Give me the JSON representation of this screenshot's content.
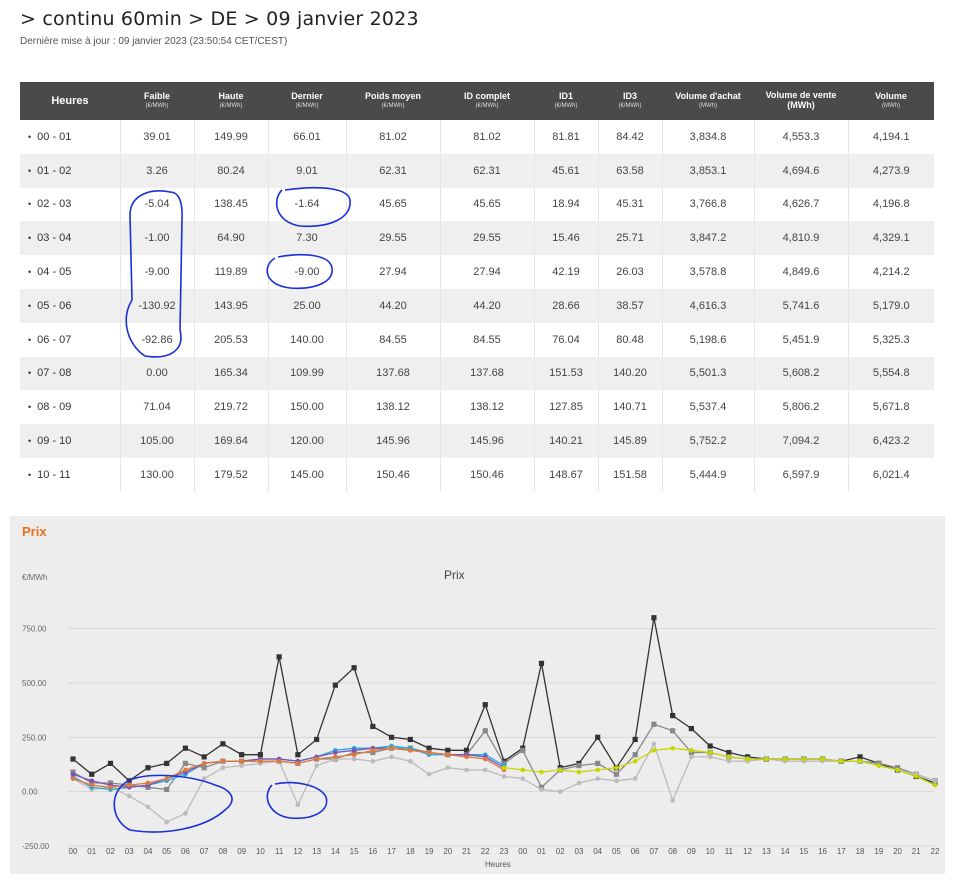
{
  "page": {
    "title": "> continu 60min > DE > 09 janvier 2023",
    "subtitle": "Dernière mise à jour : 09 janvier 2023 (23:50:54 CET/CEST)"
  },
  "table": {
    "headers": [
      {
        "label": "Heures",
        "unit": ""
      },
      {
        "label": "Faible",
        "unit": "(€/MWh)"
      },
      {
        "label": "Haute",
        "unit": "(€/MWh)"
      },
      {
        "label": "Dernier",
        "unit": "(€/MWh)"
      },
      {
        "label": "Poids moyen",
        "unit": "(€/MWh)"
      },
      {
        "label": "ID complet",
        "unit": "(€/MWh)"
      },
      {
        "label": "ID1",
        "unit": "(€/MWh)"
      },
      {
        "label": "ID3",
        "unit": "(€/MWh)"
      },
      {
        "label": "Volume d'achat",
        "unit": "(MWh)"
      },
      {
        "label": "Volume de vente (MWh)",
        "unit": ""
      },
      {
        "label": "Volume",
        "unit": "(MWh)"
      }
    ],
    "rows": [
      [
        "00 - 01",
        "39.01",
        "149.99",
        "66.01",
        "81.02",
        "81.02",
        "81.81",
        "84.42",
        "3,834.8",
        "4,553.3",
        "4,194.1"
      ],
      [
        "01 - 02",
        "3.26",
        "80.24",
        "9.01",
        "62.31",
        "62.31",
        "45.61",
        "63.58",
        "3,853.1",
        "4,694.6",
        "4,273.9"
      ],
      [
        "02 - 03",
        "-5.04",
        "138.45",
        "-1.64",
        "45.65",
        "45.65",
        "18.94",
        "45.31",
        "3,766.8",
        "4,626.7",
        "4,196.8"
      ],
      [
        "03 - 04",
        "-1.00",
        "64.90",
        "7.30",
        "29.55",
        "29.55",
        "15.46",
        "25.71",
        "3,847.2",
        "4,810.9",
        "4,329.1"
      ],
      [
        "04 - 05",
        "-9.00",
        "119.89",
        "-9.00",
        "27.94",
        "27.94",
        "42.19",
        "26.03",
        "3,578.8",
        "4,849.6",
        "4,214.2"
      ],
      [
        "05 - 06",
        "-130.92",
        "143.95",
        "25.00",
        "44.20",
        "44.20",
        "28.66",
        "38.57",
        "4,616.3",
        "5,741.6",
        "5,179.0"
      ],
      [
        "06 - 07",
        "-92.86",
        "205.53",
        "140.00",
        "84.55",
        "84.55",
        "76.04",
        "80.48",
        "5,198.6",
        "5,451.9",
        "5,325.3"
      ],
      [
        "07 - 08",
        "0.00",
        "165.34",
        "109.99",
        "137.68",
        "137.68",
        "151.53",
        "140.20",
        "5,501.3",
        "5,608.2",
        "5,554.8"
      ],
      [
        "08 - 09",
        "71.04",
        "219.72",
        "150.00",
        "138.12",
        "138.12",
        "127.85",
        "140.71",
        "5,537.4",
        "5,806.2",
        "5,671.8"
      ],
      [
        "09 - 10",
        "105.00",
        "169.64",
        "120.00",
        "145.96",
        "145.96",
        "140.21",
        "145.89",
        "5,752.2",
        "7,094.2",
        "6,423.2"
      ],
      [
        "10 - 11",
        "130.00",
        "179.52",
        "145.00",
        "150.46",
        "150.46",
        "148.67",
        "151.58",
        "5,444.9",
        "6,597.9",
        "6,021.4"
      ]
    ]
  },
  "chart_panel": {
    "tab_title": "Prix",
    "title": "Prix",
    "unit_label": "€/MWh",
    "xlabel": "Heures"
  },
  "chart_data": {
    "type": "line",
    "title": "Prix",
    "ylabel": "€/MWh",
    "xlabel": "Heures",
    "ylim": [
      -250,
      900
    ],
    "yticks": [
      "750.00",
      "500.00",
      "250.00",
      "0.00",
      "-250.00"
    ],
    "ytick_values": [
      750,
      500,
      250,
      0,
      -250
    ],
    "x": [
      "00",
      "01",
      "02",
      "03",
      "04",
      "05",
      "06",
      "07",
      "08",
      "09",
      "10",
      "11",
      "12",
      "13",
      "14",
      "15",
      "16",
      "17",
      "18",
      "19",
      "20",
      "21",
      "22",
      "23",
      "00",
      "01",
      "02",
      "03",
      "04",
      "05",
      "06",
      "07",
      "08",
      "09",
      "10",
      "11",
      "12",
      "13",
      "14",
      "15",
      "16",
      "17",
      "18",
      "19",
      "20",
      "21",
      "22"
    ],
    "grid": true,
    "series": [
      {
        "color": "#333333",
        "marker": "square",
        "values": [
          150,
          80,
          130,
          50,
          110,
          130,
          200,
          160,
          220,
          170,
          170,
          620,
          170,
          240,
          490,
          570,
          300,
          250,
          240,
          200,
          190,
          190,
          400,
          140,
          200,
          590,
          110,
          130,
          250,
          110,
          240,
          800,
          350,
          290,
          210,
          180,
          160,
          150,
          150,
          150,
          150,
          140,
          160,
          130,
          100,
          70,
          40
        ]
      },
      {
        "color": "#888888",
        "marker": "square",
        "values": [
          90,
          40,
          40,
          30,
          20,
          10,
          130,
          110,
          140,
          140,
          140,
          140,
          130,
          150,
          150,
          180,
          180,
          200,
          200,
          180,
          170,
          170,
          280,
          130,
          190,
          20,
          100,
          120,
          130,
          80,
          170,
          310,
          280,
          180,
          180,
          160,
          150,
          150,
          150,
          150,
          150,
          140,
          140,
          130,
          110,
          80,
          50
        ]
      },
      {
        "color": "#bbbbbb",
        "marker": "circle",
        "values": [
          60,
          10,
          20,
          -20,
          -70,
          -140,
          -100,
          60,
          110,
          120,
          130,
          140,
          -60,
          120,
          150,
          150,
          140,
          160,
          140,
          80,
          110,
          100,
          100,
          70,
          60,
          10,
          0,
          40,
          60,
          50,
          60,
          220,
          -40,
          160,
          160,
          140,
          140,
          150,
          140,
          140,
          140,
          140,
          140,
          120,
          100,
          80,
          50
        ]
      },
      {
        "color": "#2aa8e0",
        "marker": "circle",
        "values": [
          70,
          20,
          10,
          20,
          30,
          50,
          80,
          130,
          140,
          140,
          150,
          150,
          140,
          160,
          190,
          200,
          200,
          210,
          200,
          170,
          170,
          170,
          170,
          120,
          null,
          null,
          null,
          null,
          null,
          null,
          null,
          null,
          null,
          null,
          null,
          null,
          null,
          null,
          null,
          null,
          null,
          null,
          null,
          null,
          null,
          null,
          null
        ]
      },
      {
        "color": "#7b52b8",
        "marker": "circle",
        "values": [
          80,
          50,
          30,
          20,
          30,
          60,
          90,
          130,
          140,
          140,
          150,
          150,
          140,
          160,
          180,
          190,
          200,
          200,
          190,
          180,
          170,
          170,
          160,
          110,
          null,
          null,
          null,
          null,
          null,
          null,
          null,
          null,
          null,
          null,
          null,
          null,
          null,
          null,
          null,
          null,
          null,
          null,
          null,
          null,
          null,
          null,
          null
        ]
      },
      {
        "color": "#e07a3a",
        "marker": "circle",
        "values": [
          60,
          30,
          20,
          30,
          40,
          60,
          100,
          130,
          140,
          140,
          140,
          140,
          130,
          150,
          160,
          170,
          190,
          200,
          190,
          180,
          170,
          160,
          150,
          100,
          null,
          null,
          null,
          null,
          null,
          null,
          null,
          null,
          null,
          null,
          null,
          null,
          null,
          null,
          null,
          null,
          null,
          null,
          null,
          null,
          null,
          null,
          null
        ]
      },
      {
        "color": "#c6d800",
        "marker": "circle",
        "values": [
          null,
          null,
          null,
          null,
          null,
          null,
          null,
          null,
          null,
          null,
          null,
          null,
          null,
          null,
          null,
          null,
          null,
          null,
          null,
          null,
          null,
          null,
          null,
          110,
          100,
          90,
          100,
          90,
          100,
          110,
          140,
          190,
          200,
          190,
          180,
          160,
          150,
          150,
          150,
          150,
          150,
          140,
          140,
          120,
          100,
          70,
          30
        ]
      }
    ]
  },
  "annotations": {
    "color": "#1a2fd8"
  }
}
